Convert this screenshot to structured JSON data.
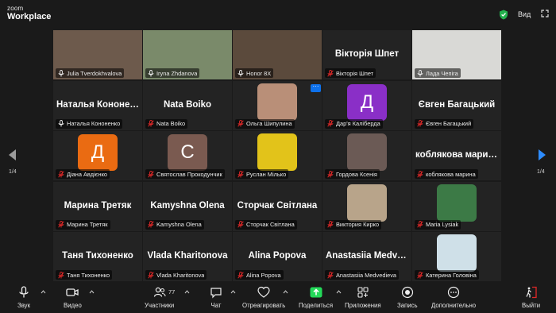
{
  "app": {
    "brand_top": "zoom",
    "brand_bottom": "Workplace"
  },
  "header": {
    "view_label": "Вид"
  },
  "pagination": {
    "left": "1/4",
    "right": "1/4"
  },
  "more_label": "···",
  "tiles": [
    {
      "type": "video",
      "name": "Julia Tverdokhvalova",
      "muted": false,
      "bg": "#6d5a4c"
    },
    {
      "type": "video",
      "name": "Iryna Zhdanova",
      "muted": false,
      "bg": "#7a8a6a"
    },
    {
      "type": "video",
      "name": "Honor 8X",
      "muted": false,
      "active": true,
      "bg": "#5b4a3c"
    },
    {
      "type": "text",
      "big": "Вікторія Шпет",
      "name": "Вікторія Шпет",
      "muted": true
    },
    {
      "type": "video",
      "name": "Лада Чепіга",
      "muted": false,
      "bg": "#d9d9d6"
    },
    {
      "type": "text",
      "big": "Наталья Кононенко",
      "name": "Наталья Кононенко",
      "muted": false
    },
    {
      "type": "text",
      "big": "Nata Boiko",
      "name": "Nata Boiko",
      "muted": true
    },
    {
      "type": "photo",
      "name": "Ольга Шипулина",
      "muted": true,
      "bg": "#b98f78"
    },
    {
      "type": "letter",
      "letter": "Д",
      "name": "Дар'я Каліберда",
      "muted": true,
      "bg": "#8a2fc7"
    },
    {
      "type": "text",
      "big": "Євген Багацький",
      "name": "Євген Багацький",
      "muted": true
    },
    {
      "type": "letter",
      "letter": "Д",
      "name": "Діана Авдієнко",
      "muted": true,
      "bg": "#ea6b12"
    },
    {
      "type": "letter",
      "letter": "С",
      "name": "Святослав Прокодунчик",
      "muted": true,
      "bg": "#7a5a50"
    },
    {
      "type": "photo",
      "name": "Руслан Мілько",
      "muted": true,
      "bg": "#e2c31a"
    },
    {
      "type": "photo",
      "name": "Гордова Ксенія",
      "muted": true,
      "bg": "#6b5a55"
    },
    {
      "type": "text",
      "big": "коблякова марина",
      "name": "коблякова марина",
      "muted": true
    },
    {
      "type": "text",
      "big": "Марина Третяк",
      "name": "Марина Третяк",
      "muted": true
    },
    {
      "type": "text",
      "big": "Kamyshna Olena",
      "name": "Kamyshna Olena",
      "muted": true
    },
    {
      "type": "text",
      "big": "Сторчак Світлана",
      "name": "Сторчак Світлана",
      "muted": true
    },
    {
      "type": "photo",
      "name": "Виктория Кирко",
      "muted": true,
      "bg": "#b8a48a"
    },
    {
      "type": "photo",
      "name": "Maria Lysiak",
      "muted": true,
      "bg": "#3c7a46"
    },
    {
      "type": "text",
      "big": "Таня Тихоненко",
      "name": "Таня Тихоненко",
      "muted": true
    },
    {
      "type": "text",
      "big": "Vlada Kharitonova",
      "name": "Vlada Kharitonova",
      "muted": true
    },
    {
      "type": "text",
      "big": "Alina Popova",
      "name": "Alina Popova",
      "muted": true
    },
    {
      "type": "text",
      "big": "Anastasiia Medvedieva",
      "name": "Anastasiia Medvedieva",
      "muted": true
    },
    {
      "type": "photo",
      "name": "Катерина Головіна",
      "muted": true,
      "bg": "#cfe0e8"
    }
  ],
  "toolbar": {
    "audio": "Звук",
    "video": "Видео",
    "participants": "Участники",
    "participants_count": "77",
    "chat": "Чат",
    "react": "Отреагировать",
    "share": "Поделиться",
    "apps": "Приложения",
    "record": "Запись",
    "more": "Дополнительно",
    "leave": "Выйти"
  },
  "colors": {
    "accent": "#0e71eb",
    "share_green": "#23d959",
    "muted_red": "#e02828"
  }
}
